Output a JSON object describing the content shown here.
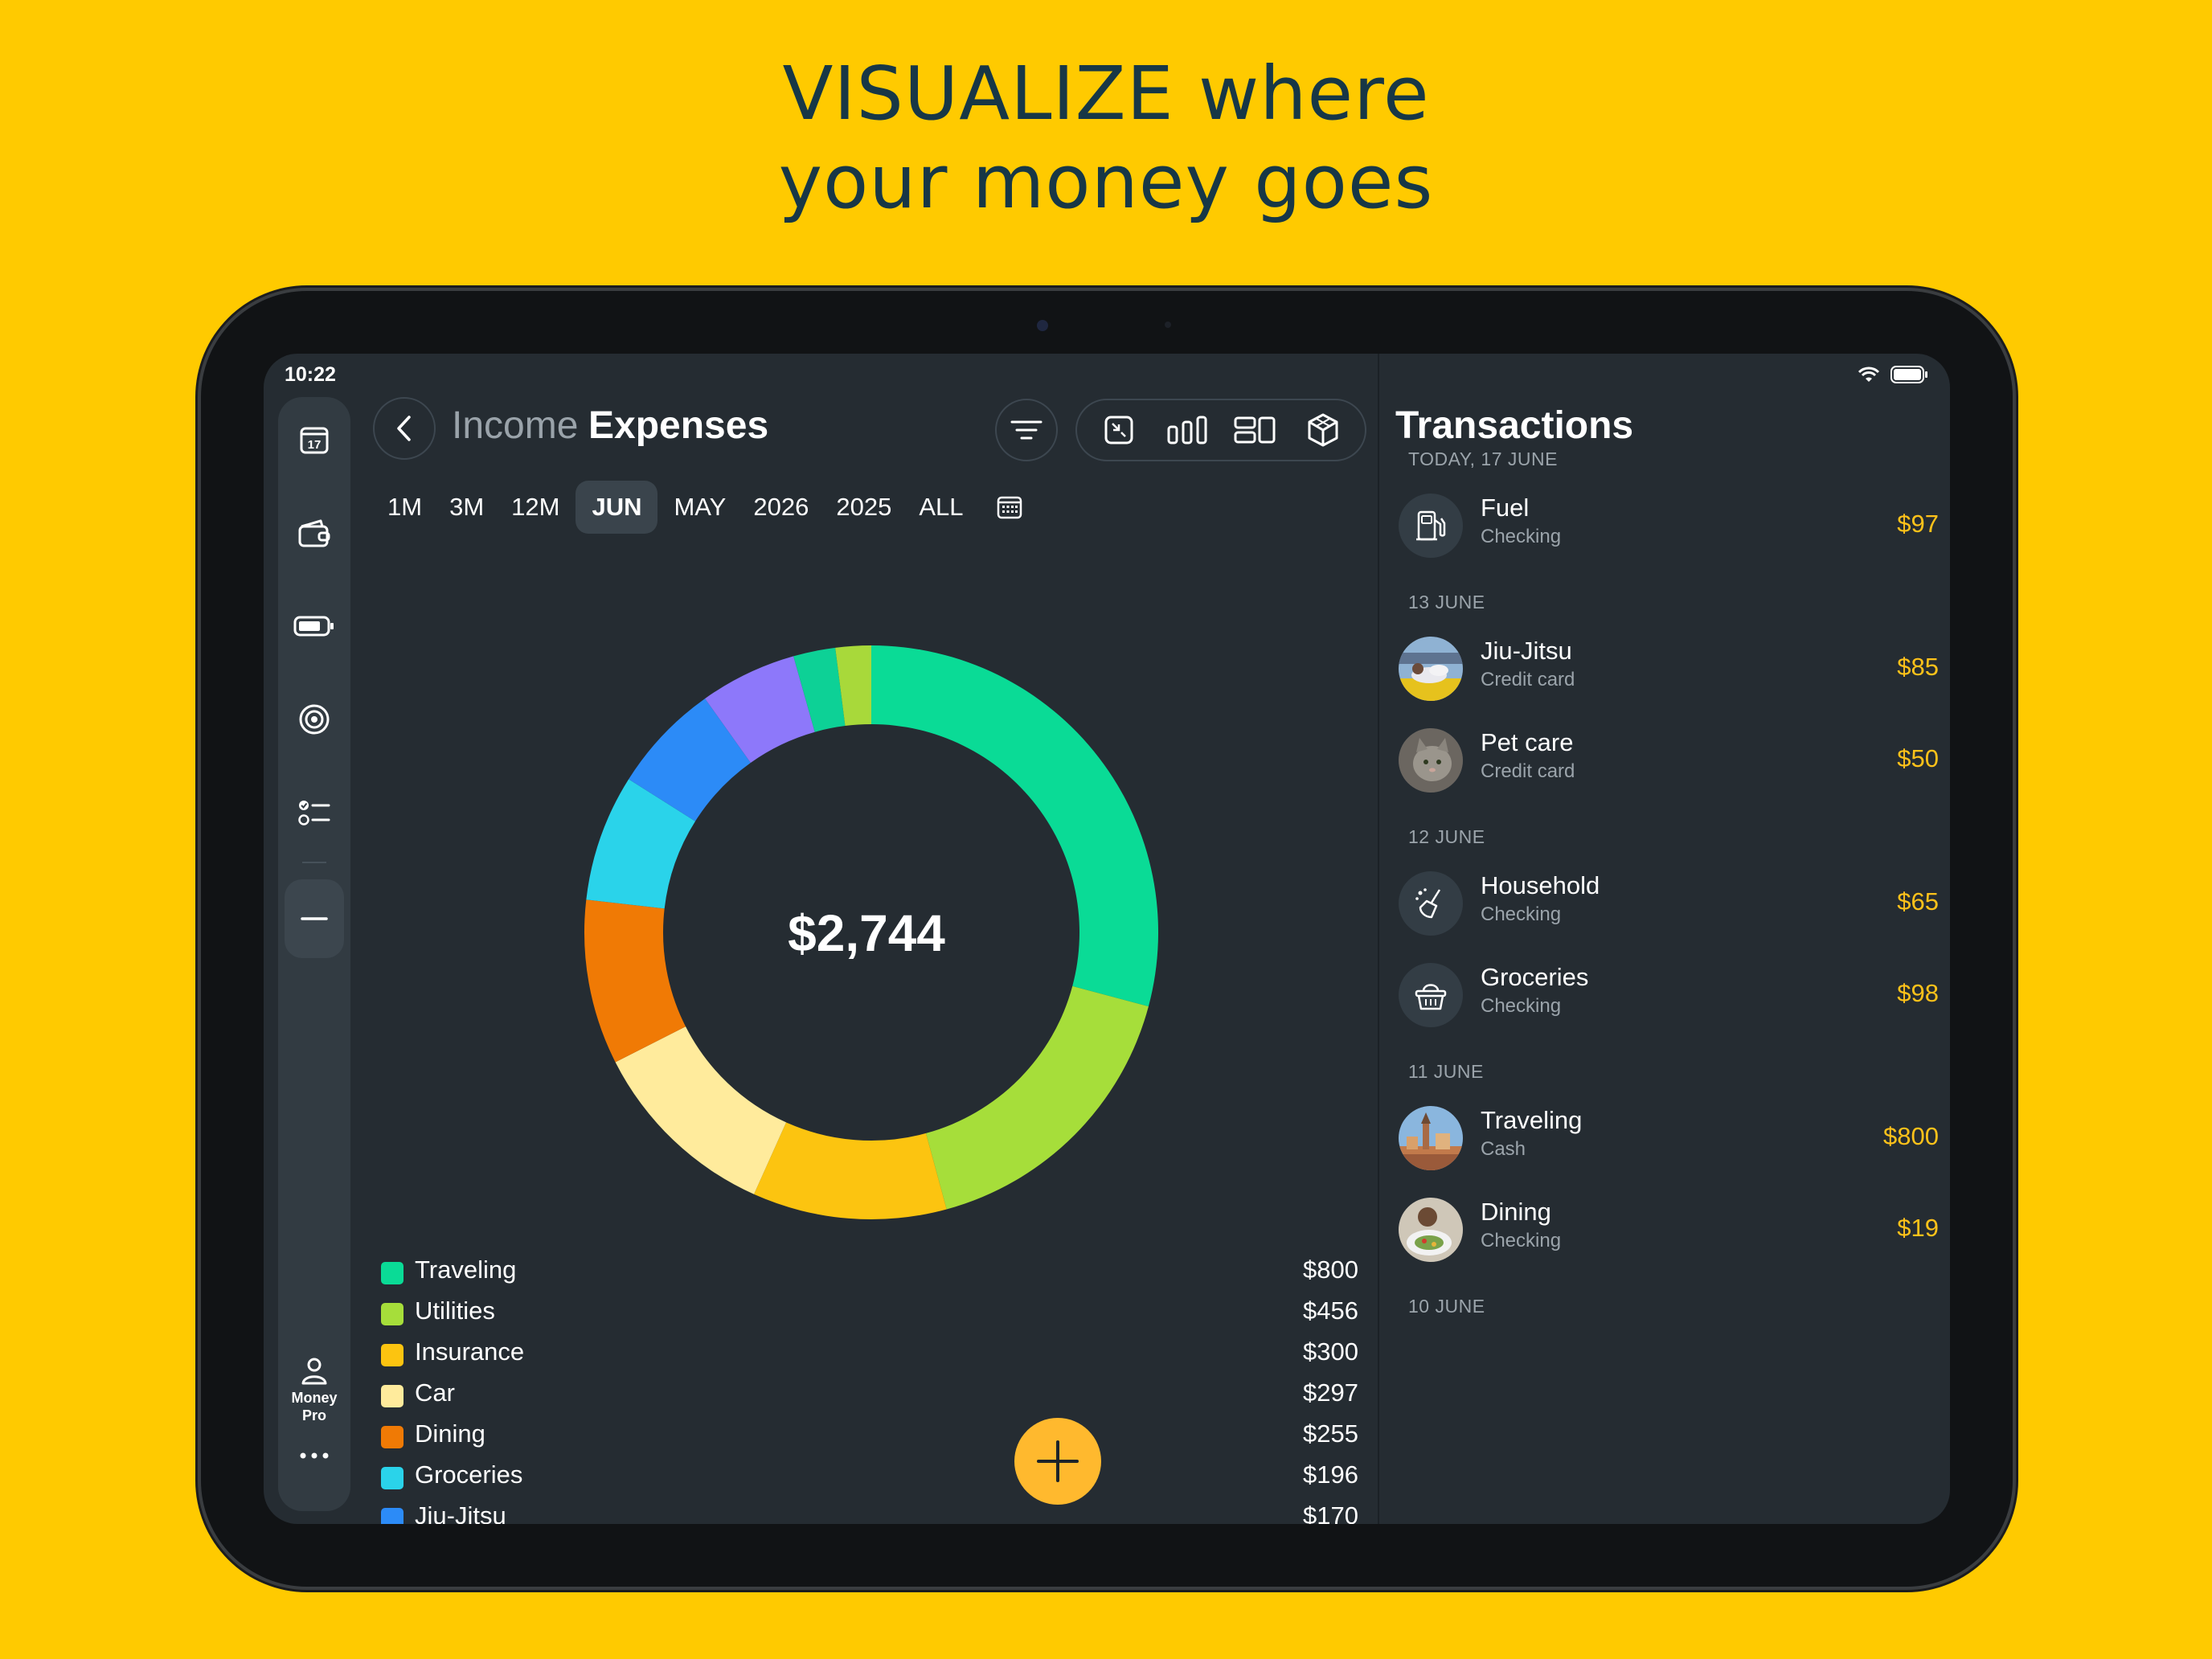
{
  "headline": {
    "line1": "VISUALIZE where",
    "line2": "your money goes"
  },
  "status_bar": {
    "time": "10:22",
    "wifi_icon": "wifi-icon",
    "battery_icon": "battery-icon"
  },
  "rail": {
    "items": [
      {
        "icon": "calendar-icon",
        "badge": "17"
      },
      {
        "icon": "wallet-icon"
      },
      {
        "icon": "battery-budget-icon"
      },
      {
        "icon": "target-icon"
      },
      {
        "icon": "checklist-icon"
      },
      {
        "icon": "minus-icon"
      }
    ],
    "profile_label_1": "Money",
    "profile_label_2": "Pro",
    "more_icon": "ellipsis-icon"
  },
  "header": {
    "income_label": "Income",
    "expenses_label": "Expenses"
  },
  "periods": [
    "1M",
    "3M",
    "12M",
    "JUN",
    "MAY",
    "2026",
    "2025",
    "ALL"
  ],
  "active_period": "JUN",
  "chart_data": {
    "type": "pie",
    "style": "donut",
    "center_label": "$2,744",
    "categories": [
      "Traveling",
      "Utilities",
      "Insurance",
      "Car",
      "Dining",
      "Groceries",
      "Jiu-Jitsu",
      "Pet care",
      "Household",
      "Fuel"
    ],
    "values": [
      800,
      456,
      300,
      297,
      255,
      196,
      170,
      150,
      65,
      55
    ],
    "colors": [
      "#0ADB96",
      "#A6DE3A",
      "#FCC410",
      "#FFEB9C",
      "#F07A05",
      "#2AD3EA",
      "#2C8BF7",
      "#8D78FA",
      "#0DD196",
      "#A8D93A"
    ]
  },
  "legend": [
    {
      "name": "Traveling",
      "value": "$800",
      "color": "#0ADB96"
    },
    {
      "name": "Utilities",
      "value": "$456",
      "color": "#A6DE3A"
    },
    {
      "name": "Insurance",
      "value": "$300",
      "color": "#FCC410"
    },
    {
      "name": "Car",
      "value": "$297",
      "color": "#FFEB9C"
    },
    {
      "name": "Dining",
      "value": "$255",
      "color": "#F07A05"
    },
    {
      "name": "Groceries",
      "value": "$196",
      "color": "#2AD3EA"
    },
    {
      "name": "Jiu-Jitsu",
      "value": "$170",
      "color": "#2C8BF7"
    }
  ],
  "transactions": {
    "title": "Transactions",
    "groups": [
      {
        "date": "TODAY, 17 JUNE",
        "items": [
          {
            "name": "Fuel",
            "account": "Checking",
            "amount": "$97",
            "icon": "fuel-pump-icon"
          }
        ]
      },
      {
        "date": "13 JUNE",
        "items": [
          {
            "name": "Jiu-Jitsu",
            "account": "Credit card",
            "amount": "$85",
            "icon": "jiu-jitsu-photo"
          },
          {
            "name": "Pet care",
            "account": "Credit card",
            "amount": "$50",
            "icon": "cat-photo"
          }
        ]
      },
      {
        "date": "12 JUNE",
        "items": [
          {
            "name": "Household",
            "account": "Checking",
            "amount": "$65",
            "icon": "cleaning-icon"
          },
          {
            "name": "Groceries",
            "account": "Checking",
            "amount": "$98",
            "icon": "basket-icon"
          }
        ]
      },
      {
        "date": "11 JUNE",
        "items": [
          {
            "name": "Traveling",
            "account": "Cash",
            "amount": "$800",
            "icon": "city-photo"
          },
          {
            "name": "Dining",
            "account": "Checking",
            "amount": "$19",
            "icon": "dining-photo"
          }
        ]
      },
      {
        "date": "10 JUNE",
        "items": []
      }
    ]
  },
  "accent_color": "#FFC21A"
}
